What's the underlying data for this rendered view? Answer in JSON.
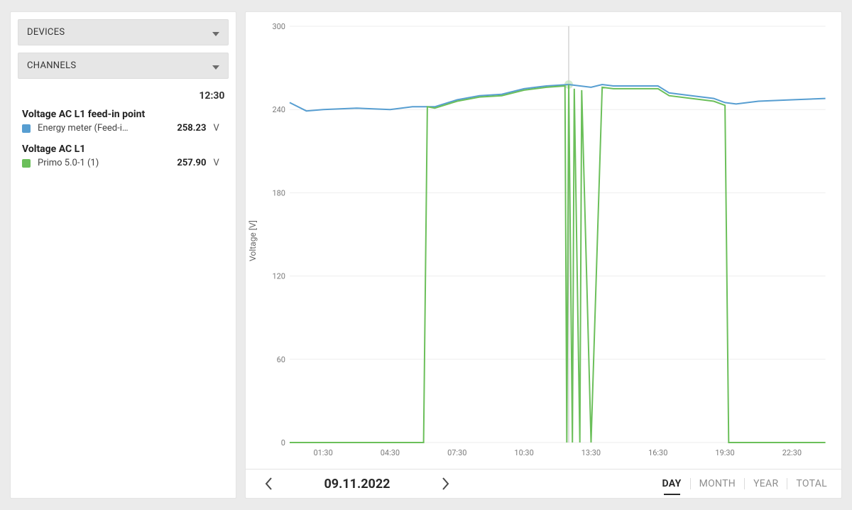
{
  "sidebar": {
    "buttons": {
      "devices": "DEVICES",
      "channels": "CHANNELS"
    },
    "header_time": "12:30",
    "groups": [
      {
        "title": "Voltage AC L1 feed-in point",
        "entry": {
          "swatch": "#579ed1",
          "name": "Energy meter (Feed-i…",
          "value": "258.23",
          "unit": "V"
        }
      },
      {
        "title": "Voltage AC L1",
        "entry": {
          "swatch": "#6bbf5a",
          "name": "Primo 5.0-1 (1)",
          "value": "257.90",
          "unit": "V"
        }
      }
    ]
  },
  "footer": {
    "date": "09.11.2022",
    "ranges": [
      "DAY",
      "MONTH",
      "YEAR",
      "TOTAL"
    ],
    "active": "DAY"
  },
  "ylabel": "Voltage [V]",
  "chart_data": {
    "type": "line",
    "title": "",
    "xlabel": "",
    "ylabel": "Voltage [V]",
    "ylim": [
      0,
      300
    ],
    "yticks": [
      0,
      60,
      120,
      180,
      240,
      300
    ],
    "x_range_hours": [
      0,
      24
    ],
    "xticks": [
      "01:30",
      "04:30",
      "07:30",
      "10:30",
      "13:30",
      "16:30",
      "19:30",
      "22:30"
    ],
    "crosshair_time": "12:30",
    "crosshair_values": {
      "Energy meter (Feed-in)": 258.23,
      "Primo 5.0-1 (1)": 257.9
    },
    "series": [
      {
        "name": "Energy meter (Feed-in)",
        "color": "#579ed1",
        "x": [
          "00:00",
          "00:45",
          "01:30",
          "03:00",
          "04:30",
          "05:30",
          "06:00",
          "06:30",
          "07:30",
          "08:30",
          "09:30",
          "10:30",
          "11:30",
          "12:30",
          "13:30",
          "14:00",
          "14:30",
          "15:30",
          "16:30",
          "17:00",
          "18:00",
          "19:00",
          "19:30",
          "20:00",
          "21:00",
          "22:30",
          "24:00"
        ],
        "values": [
          245,
          239,
          240,
          241,
          240,
          242,
          242,
          242,
          247,
          250,
          251,
          255,
          257,
          258,
          256,
          258,
          257,
          257,
          257,
          252,
          250,
          248,
          245,
          244,
          246,
          247,
          248
        ]
      },
      {
        "name": "Primo 5.0-1 (1)",
        "color": "#6bbf5a",
        "x": [
          "00:00",
          "06:00",
          "06:10",
          "06:30",
          "07:30",
          "08:30",
          "09:30",
          "10:30",
          "11:30",
          "12:20",
          "12:25",
          "12:30",
          "12:40",
          "12:45",
          "13:00",
          "13:05",
          "13:30",
          "14:00",
          "14:30",
          "15:30",
          "16:30",
          "17:00",
          "18:00",
          "19:00",
          "19:30",
          "19:40",
          "24:00"
        ],
        "values": [
          0,
          0,
          242,
          241,
          246,
          249,
          250,
          254,
          256,
          257,
          0,
          258,
          0,
          255,
          0,
          254,
          0,
          256,
          255,
          255,
          255,
          250,
          248,
          246,
          243,
          0,
          0
        ]
      }
    ]
  }
}
